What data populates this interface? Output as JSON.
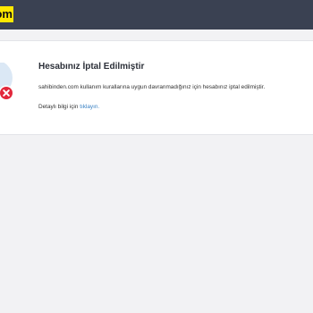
{
  "header": {
    "logo_text": "sahibinden.com",
    "background_color": "#3a4152",
    "logo_color": "#ffe800"
  },
  "notice": {
    "title": "Hesabınız İptal Edilmiştir",
    "message": "sahibinden.com kullanım kurallarına uygun davranmadığınız için hesabınız iptal edilmiştir.",
    "detail_prefix": "Detaylı bilgi için",
    "detail_link": "tıklayın.",
    "illustration_icons": [
      "user-avatar-icon",
      "error-x-icon"
    ],
    "error_color": "#e2273b",
    "link_color": "#3a82c4"
  }
}
